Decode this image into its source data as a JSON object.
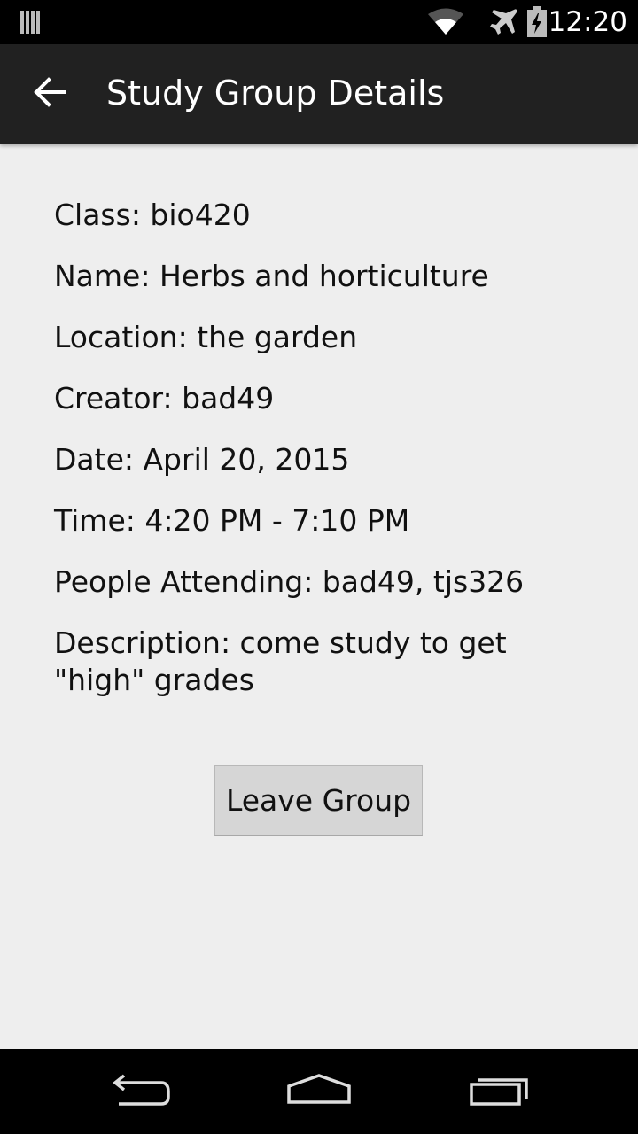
{
  "status_bar": {
    "time": "12:20",
    "icons": [
      "notification-icon",
      "wifi-icon",
      "airplane-mode-icon",
      "battery-charging-icon"
    ]
  },
  "action_bar": {
    "title": "Study Group Details",
    "back_icon": "arrow-back-icon"
  },
  "details": {
    "class": "Class: bio420",
    "name": "Name: Herbs and horticulture",
    "location": "Location: the garden",
    "creator": "Creator: bad49",
    "date": "Date: April 20, 2015",
    "time": "Time: 4:20 PM - 7:10 PM",
    "people_attending": "People Attending: bad49, tjs326",
    "description": "Description: come study to get \"high\" grades"
  },
  "leave_button": {
    "label": "Leave Group"
  },
  "nav_bar": {
    "icons": [
      "back-nav-icon",
      "home-nav-icon",
      "recents-nav-icon"
    ]
  },
  "colors": {
    "action_bar": "#212121",
    "background": "#eeeeee",
    "button": "#d6d6d6",
    "status_bar": "#000000"
  }
}
